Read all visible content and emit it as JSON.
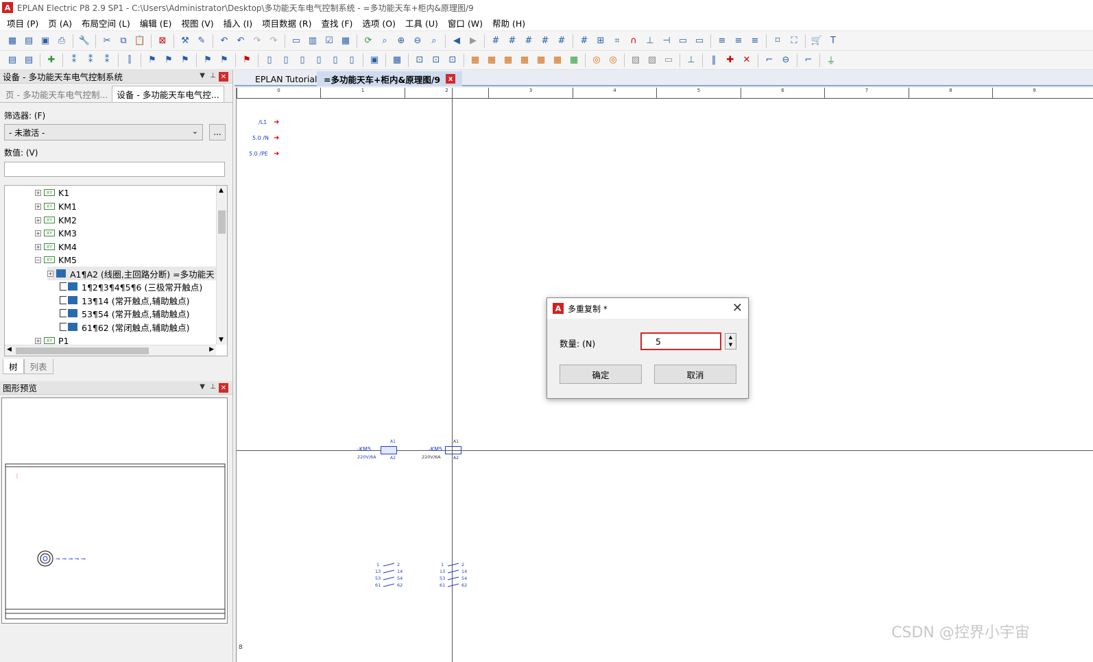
{
  "window": {
    "title": "EPLAN Electric P8 2.9 SP1 - C:\\Users\\Administrator\\Desktop\\多功能天车电气控制系统 - =多功能天车+柜内&原理图/9",
    "logo": "A"
  },
  "menu": [
    "项目 (P)",
    "页 (A)",
    "布局空间 (L)",
    "编辑 (E)",
    "视图 (V)",
    "插入 (I)",
    "项目数据 (R)",
    "查找 (F)",
    "选项 (O)",
    "工具 (U)",
    "窗口 (W)",
    "帮助 (H)"
  ],
  "device_panel": {
    "title": "设备 - 多功能天车电气控制系统",
    "subtabs": [
      "页 - 多功能天车电气控制...",
      "设备 - 多功能天车电气控..."
    ],
    "filter_label": "筛选器: (F)",
    "filter_value": "- 未激活 -",
    "dots": "...",
    "value_label": "数值: (V)",
    "tree": [
      {
        "label": "K1",
        "kind": "xy"
      },
      {
        "label": "KM1",
        "kind": "xy"
      },
      {
        "label": "KM2",
        "kind": "xy"
      },
      {
        "label": "KM3",
        "kind": "xy"
      },
      {
        "label": "KM4",
        "kind": "xy"
      },
      {
        "label": "KM5",
        "kind": "xy-open"
      },
      {
        "label": "A1¶A2 (线圈,主回路分断) =多功能天",
        "kind": "device"
      },
      {
        "label": "1¶2¶3¶4¶5¶6 (三极常开触点)",
        "kind": "contact"
      },
      {
        "label": "13¶14 (常开触点,辅助触点)",
        "kind": "contact"
      },
      {
        "label": "53¶54 (常开触点,辅助触点)",
        "kind": "contact"
      },
      {
        "label": "61¶62 (常闭触点,辅助触点)",
        "kind": "contact"
      },
      {
        "label": "P1",
        "kind": "xy"
      }
    ],
    "bottom_tabs": [
      "树",
      "列表"
    ]
  },
  "preview_panel": {
    "title": "图形预览"
  },
  "doc_tabs": [
    {
      "label": "EPLAN Tutorials"
    },
    {
      "label": "=多功能天车+柜内&原理图/9",
      "close": "x"
    }
  ],
  "drawing": {
    "ruler": [
      "0",
      "1",
      "2",
      "3",
      "4",
      "5",
      "6",
      "7",
      "8",
      "9"
    ],
    "potentials": [
      "/L1",
      "5.0 /N",
      "5.0 /PE"
    ],
    "coil_labels": [
      "-KM5",
      "220V/6A",
      "A1",
      "A2"
    ],
    "contact_numbers": [
      "1",
      "2",
      "13",
      "14",
      "53",
      "54",
      "61",
      "62"
    ],
    "page_number": "8"
  },
  "dialog": {
    "title": "多重复制 *",
    "close": "✕",
    "quantity_label": "数量: (N)",
    "quantity_value": "5",
    "ok": "确定",
    "cancel": "取消"
  },
  "watermark": "CSDN @控界小宇宙",
  "colors": {
    "accent_red": "#e02020",
    "tab_active": "#cfdcf0",
    "schematic_blue": "#1e3ad6"
  }
}
